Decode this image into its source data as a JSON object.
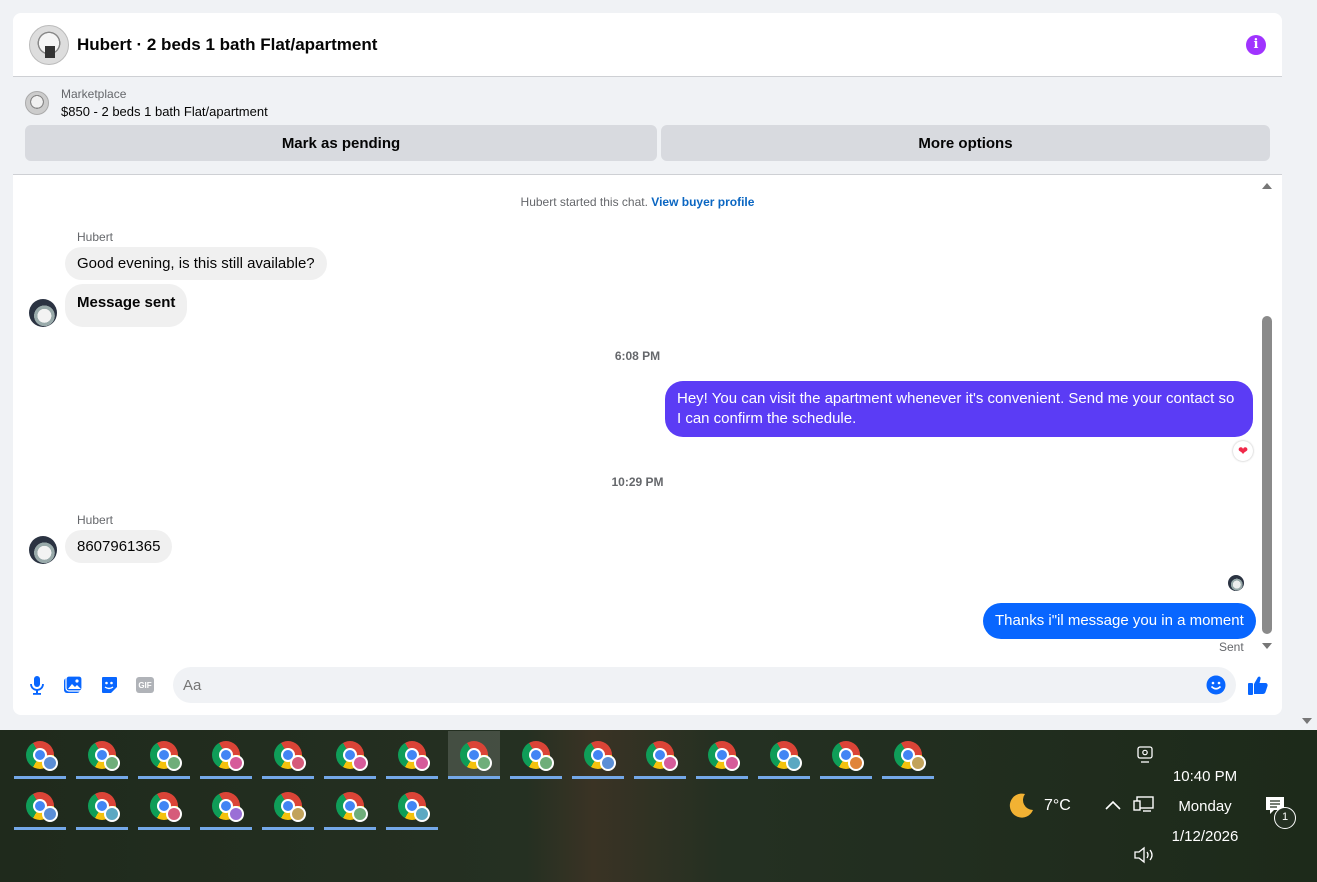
{
  "header": {
    "title": "Hubert · 2 beds 1 bath Flat/apartment"
  },
  "marketplace": {
    "label": "Marketplace",
    "item": "$850 - 2 beds 1 bath Flat/apartment",
    "mark_pending": "Mark as pending",
    "more_options": "More options"
  },
  "messages": {
    "started_text": "Hubert started this chat. ",
    "view_profile": "View buyer profile",
    "sender1": "Hubert",
    "msg1": "Good evening, is this still available?",
    "msg2": "Message sent",
    "time1": "6:08 PM",
    "msg3": "Hey! You can visit the apartment whenever it's convenient. Send me your contact so I can confirm the schedule.",
    "reaction": "❤",
    "time2": "10:29 PM",
    "sender2": "Hubert",
    "msg4": "8607961365",
    "msg5": "Thanks i\"il message you in a moment",
    "sent_status": "Sent"
  },
  "composer": {
    "placeholder": "Aa",
    "gif": "GIF"
  },
  "taskbar": {
    "row1_badges": [
      "#5b8ed6",
      "#6fae7a",
      "#6fae7a",
      "#d65b9a",
      "#d65b7a",
      "#d65b9a",
      "#d65b9a",
      "#6fae7a",
      "#6fae7a",
      "#5b8ed6",
      "#d65b9a",
      "#d65b9a",
      "#5ba8c2",
      "#e0843a",
      "#c2a35b"
    ],
    "row2_badges": [
      "#5b8ed6",
      "#5ba8c2",
      "#d65b7a",
      "#9a6fd6",
      "#c2a35b",
      "#6fae7a",
      "#5ba8c2"
    ],
    "active_index": 7
  },
  "tray": {
    "temperature": "7°C",
    "time": "10:40 PM",
    "day": "Monday",
    "date": "1/12/2026",
    "notification_count": "1"
  }
}
